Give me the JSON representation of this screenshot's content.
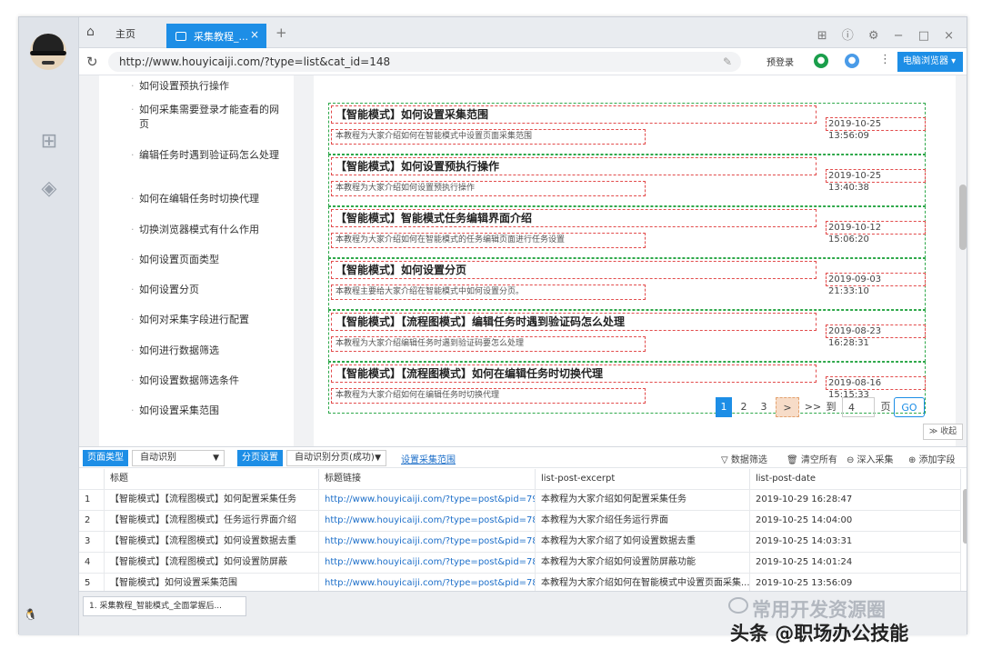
{
  "tabs": {
    "home": "主页",
    "active": "采集教程_...",
    "close": "×",
    "plus": "+"
  },
  "window_controls": "⊞ ⓘ ⚙ − □ ×",
  "address": {
    "url": "http://www.houyicaiji.com/?type=list&cat_id=148",
    "login": "预登录",
    "mode": "电脑浏览器"
  },
  "sidenav": [
    "如何设置预执行操作",
    "如何采集需要登录才能查看的网页",
    "编辑任务时遇到验证码怎么处理",
    "如何在编辑任务时切换代理",
    "切换浏览器模式有什么作用",
    "如何设置页面类型",
    "如何设置分页",
    "如何对采集字段进行配置",
    "如何进行数据筛选",
    "如何设置数据筛选条件",
    "如何设置采集范围"
  ],
  "posts": [
    {
      "title": "【智能模式】如何设置采集范围",
      "desc": "本教程为大家介绍如何在智能模式中设置页面采集范围",
      "date": "2019-10-25 13:56:09"
    },
    {
      "title": "【智能模式】如何设置预执行操作",
      "desc": "本教程为大家介绍如何设置预执行操作",
      "date": "2019-10-25 13:40:38"
    },
    {
      "title": "【智能模式】智能模式任务编辑界面介绍",
      "desc": "本教程为大家介绍如何在智能模式的任务编辑页面进行任务设置",
      "date": "2019-10-12 15:06:20"
    },
    {
      "title": "【智能模式】如何设置分页",
      "desc": "本教程主要给大家介绍在智能模式中如何设置分页。",
      "date": "2019-09-03 21:33:10"
    },
    {
      "title": "【智能模式】【流程图模式】编辑任务时遇到验证码怎么处理",
      "desc": "本教程为大家介绍编辑任务时遇到验证码要怎么处理",
      "date": "2019-08-23 16:28:31"
    },
    {
      "title": "【智能模式】【流程图模式】如何在编辑任务时切换代理",
      "desc": "本教程为大家介绍如何在编辑任务时切换代理",
      "date": "2019-08-16 15:15:33"
    }
  ],
  "pager": {
    "p1": "1",
    "p2": "2",
    "p3": "3",
    "next": ">",
    "last": ">>",
    "goto": "到",
    "page_value": "4",
    "page_unit": "页",
    "go": "GO",
    "collapse": "≫ 收起"
  },
  "toolbar": {
    "page_type_label": "页面类型",
    "page_type_value": "自动识别",
    "paging_label": "分页设置",
    "paging_value": "自动识别分页(成功)",
    "range_link": "设置采集范围",
    "filter": "▽ 数据筛选",
    "clear": "🗑 清空所有",
    "deep": "⊖ 深入采集",
    "add": "⊕ 添加字段"
  },
  "grid": {
    "headers": [
      "标题",
      "标题链接",
      "list-post-excerpt",
      "list-post-date"
    ],
    "rows": [
      {
        "n": "1",
        "title": "【智能模式】【流程图模式】如何配置采集任务",
        "link": "http://www.houyicaiji.com/?type=post&pid=7955",
        "excerpt": "本教程为大家介绍如何配置采集任务",
        "date": "2019-10-29 16:28:47"
      },
      {
        "n": "2",
        "title": "【智能模式】【流程图模式】任务运行界面介绍",
        "link": "http://www.houyicaiji.com/?type=post&pid=7809",
        "excerpt": "本教程为大家介绍任务运行界面",
        "date": "2019-10-25 14:04:00"
      },
      {
        "n": "3",
        "title": "【智能模式】【流程图模式】如何设置数据去重",
        "link": "http://www.houyicaiji.com/?type=post&pid=7807",
        "excerpt": "本教程为大家介绍了如何设置数据去重",
        "date": "2019-10-25 14:03:31"
      },
      {
        "n": "4",
        "title": "【智能模式】【流程图模式】如何设置防屏蔽",
        "link": "http://www.houyicaiji.com/?type=post&pid=7805",
        "excerpt": "本教程为大家介绍如何设置防屏蔽功能",
        "date": "2019-10-25 14:01:24"
      },
      {
        "n": "5",
        "title": "【智能模式】如何设置采集范围",
        "link": "http://www.houyicaiji.com/?type=post&pid=7803",
        "excerpt": "本教程为大家介绍如何在智能模式中设置页面采集...",
        "date": "2019-10-25 13:56:09"
      }
    ]
  },
  "status": {
    "task": "1. 采集教程_智能模式_全面掌握后...",
    "watermark1": "常用开发资源圈",
    "watermark2": "头条 @职场办公技能"
  },
  "colors": {
    "accent": "#1d8ee6",
    "select_title": "#e24b4b",
    "select_block": "#2ea84a"
  }
}
